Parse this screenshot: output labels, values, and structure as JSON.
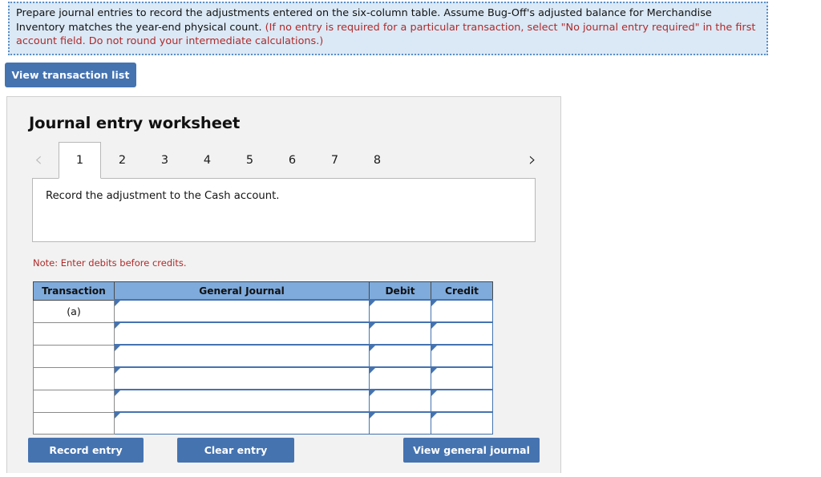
{
  "instruction": {
    "main_text": "Prepare journal entries to record the adjustments entered on the six-column table. Assume Bug-Off's adjusted balance for Merchandise Inventory matches the year-end physical count. ",
    "hint_text": "(If no entry is required for a particular transaction, select \"No journal entry required\" in the first account field. Do not round your intermediate calculations.)"
  },
  "toolbar": {
    "view_transaction_list_label": "View transaction list"
  },
  "panel": {
    "title": "Journal entry worksheet",
    "prev_arrow": "‹",
    "next_arrow": "›",
    "tabs": [
      {
        "label": "1",
        "active": true
      },
      {
        "label": "2",
        "active": false
      },
      {
        "label": "3",
        "active": false
      },
      {
        "label": "4",
        "active": false
      },
      {
        "label": "5",
        "active": false
      },
      {
        "label": "6",
        "active": false
      },
      {
        "label": "7",
        "active": false
      },
      {
        "label": "8",
        "active": false
      }
    ],
    "scenario_text": "Record the adjustment to the Cash account.",
    "note_text": "Note: Enter debits before credits."
  },
  "table": {
    "headers": {
      "transaction": "Transaction",
      "general_journal": "General Journal",
      "debit": "Debit",
      "credit": "Credit"
    },
    "rows": [
      {
        "transaction": "(a)",
        "general_journal": "",
        "debit": "",
        "credit": ""
      },
      {
        "transaction": "",
        "general_journal": "",
        "debit": "",
        "credit": ""
      },
      {
        "transaction": "",
        "general_journal": "",
        "debit": "",
        "credit": ""
      },
      {
        "transaction": "",
        "general_journal": "",
        "debit": "",
        "credit": ""
      },
      {
        "transaction": "",
        "general_journal": "",
        "debit": "",
        "credit": ""
      },
      {
        "transaction": "",
        "general_journal": "",
        "debit": "",
        "credit": ""
      }
    ]
  },
  "footer": {
    "record_entry_label": "Record entry",
    "clear_entry_label": "Clear entry",
    "view_general_journal_label": "View general journal"
  },
  "colors": {
    "accent_blue": "#4573b0",
    "table_header_blue": "#7fabdc",
    "banner_bg": "#dbe9f6",
    "banner_border": "#5b8fc9",
    "panel_bg": "#f2f2f2",
    "note_red": "#b02a2a"
  }
}
